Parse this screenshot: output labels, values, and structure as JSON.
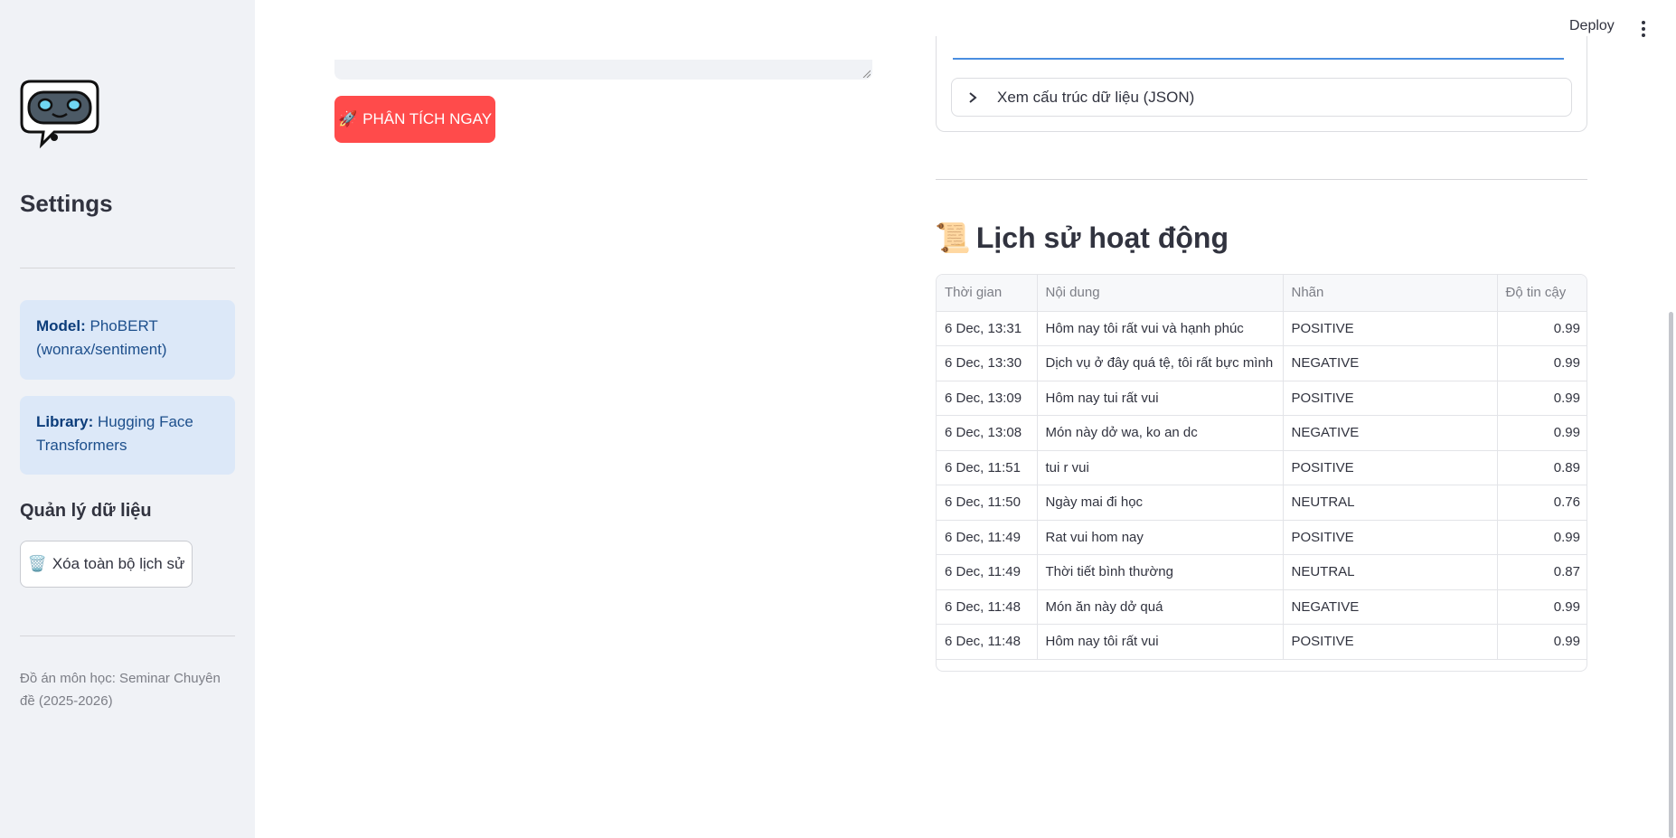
{
  "header": {
    "deploy_label": "Deploy",
    "menu_icon": "kebab-menu-icon"
  },
  "sidebar": {
    "logo_icon": "robot-chat-icon",
    "title": "Settings",
    "model_box": {
      "label": "Model:",
      "value": "PhoBERT (wonrax/sentiment)"
    },
    "library_box": {
      "label": "Library:",
      "value": "Hugging Face Transformers"
    },
    "data_section_title": "Quản lý dữ liệu",
    "clear_button": {
      "icon": "🗑️",
      "label": "Xóa toàn bộ lịch sử"
    },
    "footer_note": "Đồ án môn học: Seminar Chuyên đề (2025-2026)"
  },
  "main": {
    "analyze_button": {
      "icon": "🚀",
      "label": "PHÂN TÍCH NGAY"
    }
  },
  "result": {
    "expander_label": "Xem cấu trúc dữ liệu (JSON)",
    "expander_icon": "chevron-right-icon"
  },
  "history": {
    "icon": "📜",
    "title": "Lịch sử hoạt động",
    "columns": [
      "Thời gian",
      "Nội dung",
      "Nhãn",
      "Độ tin cậy"
    ],
    "rows": [
      {
        "time": "6 Dec, 13:31",
        "content": "Hôm nay tôi rất vui và hạnh phúc",
        "label": "POSITIVE",
        "score": "0.99"
      },
      {
        "time": "6 Dec, 13:30",
        "content": "Dịch vụ ở đây quá tệ, tôi rất bực mình",
        "label": "NEGATIVE",
        "score": "0.99"
      },
      {
        "time": "6 Dec, 13:09",
        "content": "Hôm nay tui rất vui",
        "label": "POSITIVE",
        "score": "0.99"
      },
      {
        "time": "6 Dec, 13:08",
        "content": "Món này dở wa, ko an dc",
        "label": "NEGATIVE",
        "score": "0.99"
      },
      {
        "time": "6 Dec, 11:51",
        "content": "tui r vui",
        "label": "POSITIVE",
        "score": "0.89"
      },
      {
        "time": "6 Dec, 11:50",
        "content": "Ngày mai đi học",
        "label": "NEUTRAL",
        "score": "0.76"
      },
      {
        "time": "6 Dec, 11:49",
        "content": "Rat vui hom nay",
        "label": "POSITIVE",
        "score": "0.99"
      },
      {
        "time": "6 Dec, 11:49",
        "content": "Thời tiết bình thường",
        "label": "NEUTRAL",
        "score": "0.87"
      },
      {
        "time": "6 Dec, 11:48",
        "content": "Món ăn này dở quá",
        "label": "NEGATIVE",
        "score": "0.99"
      },
      {
        "time": "6 Dec, 11:48",
        "content": "Hôm nay tôi rất vui",
        "label": "POSITIVE",
        "score": "0.99"
      }
    ]
  }
}
